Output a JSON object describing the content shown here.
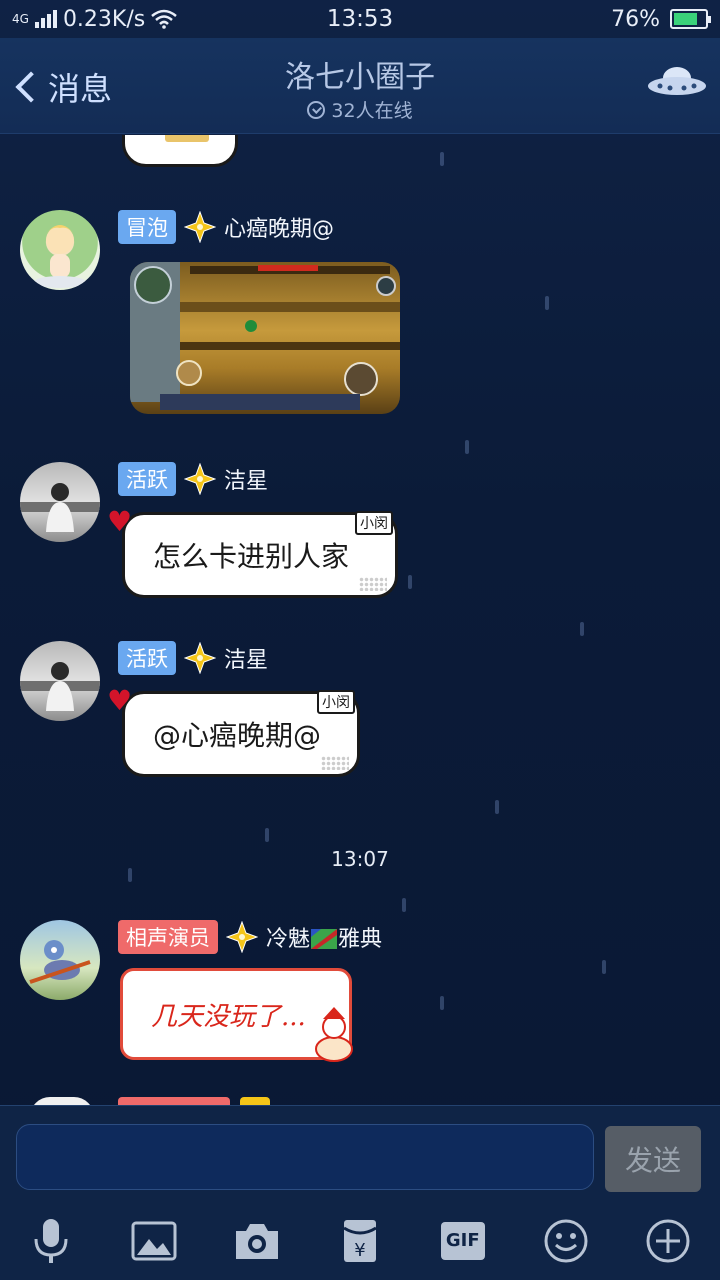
{
  "status_bar": {
    "network": "4G",
    "speed": "0.23K/s",
    "time": "13:53",
    "battery": "76%"
  },
  "header": {
    "back_label": "消息",
    "title": "洛七小圈子",
    "online": "32人在线"
  },
  "messages": [
    {
      "badge": "冒泡",
      "badge_color": "#6aa8f0",
      "name": "心癌晚期@",
      "type": "image"
    },
    {
      "badge": "活跃",
      "badge_color": "#6aa8f0",
      "name": "洁星",
      "type": "text",
      "text": "怎么卡进别人家",
      "tag": "小闵"
    },
    {
      "badge": "活跃",
      "badge_color": "#6aa8f0",
      "name": "洁星",
      "type": "text",
      "text": "@心癌晚期@",
      "tag": "小闵"
    },
    {
      "badge": "相声演员",
      "badge_color": "#ef6a6a",
      "name": "冷魅",
      "name_suffix": "雅典",
      "type": "sticker",
      "text": "几天没玩了..."
    }
  ],
  "time_separator": "13:07",
  "input": {
    "placeholder": "",
    "send_label": "发送"
  },
  "toolbar": {
    "icons": [
      "mic-icon",
      "image-icon",
      "camera-icon",
      "red-packet-icon",
      "gif-icon",
      "emoji-icon",
      "plus-icon"
    ],
    "gif_label": "GIF"
  }
}
